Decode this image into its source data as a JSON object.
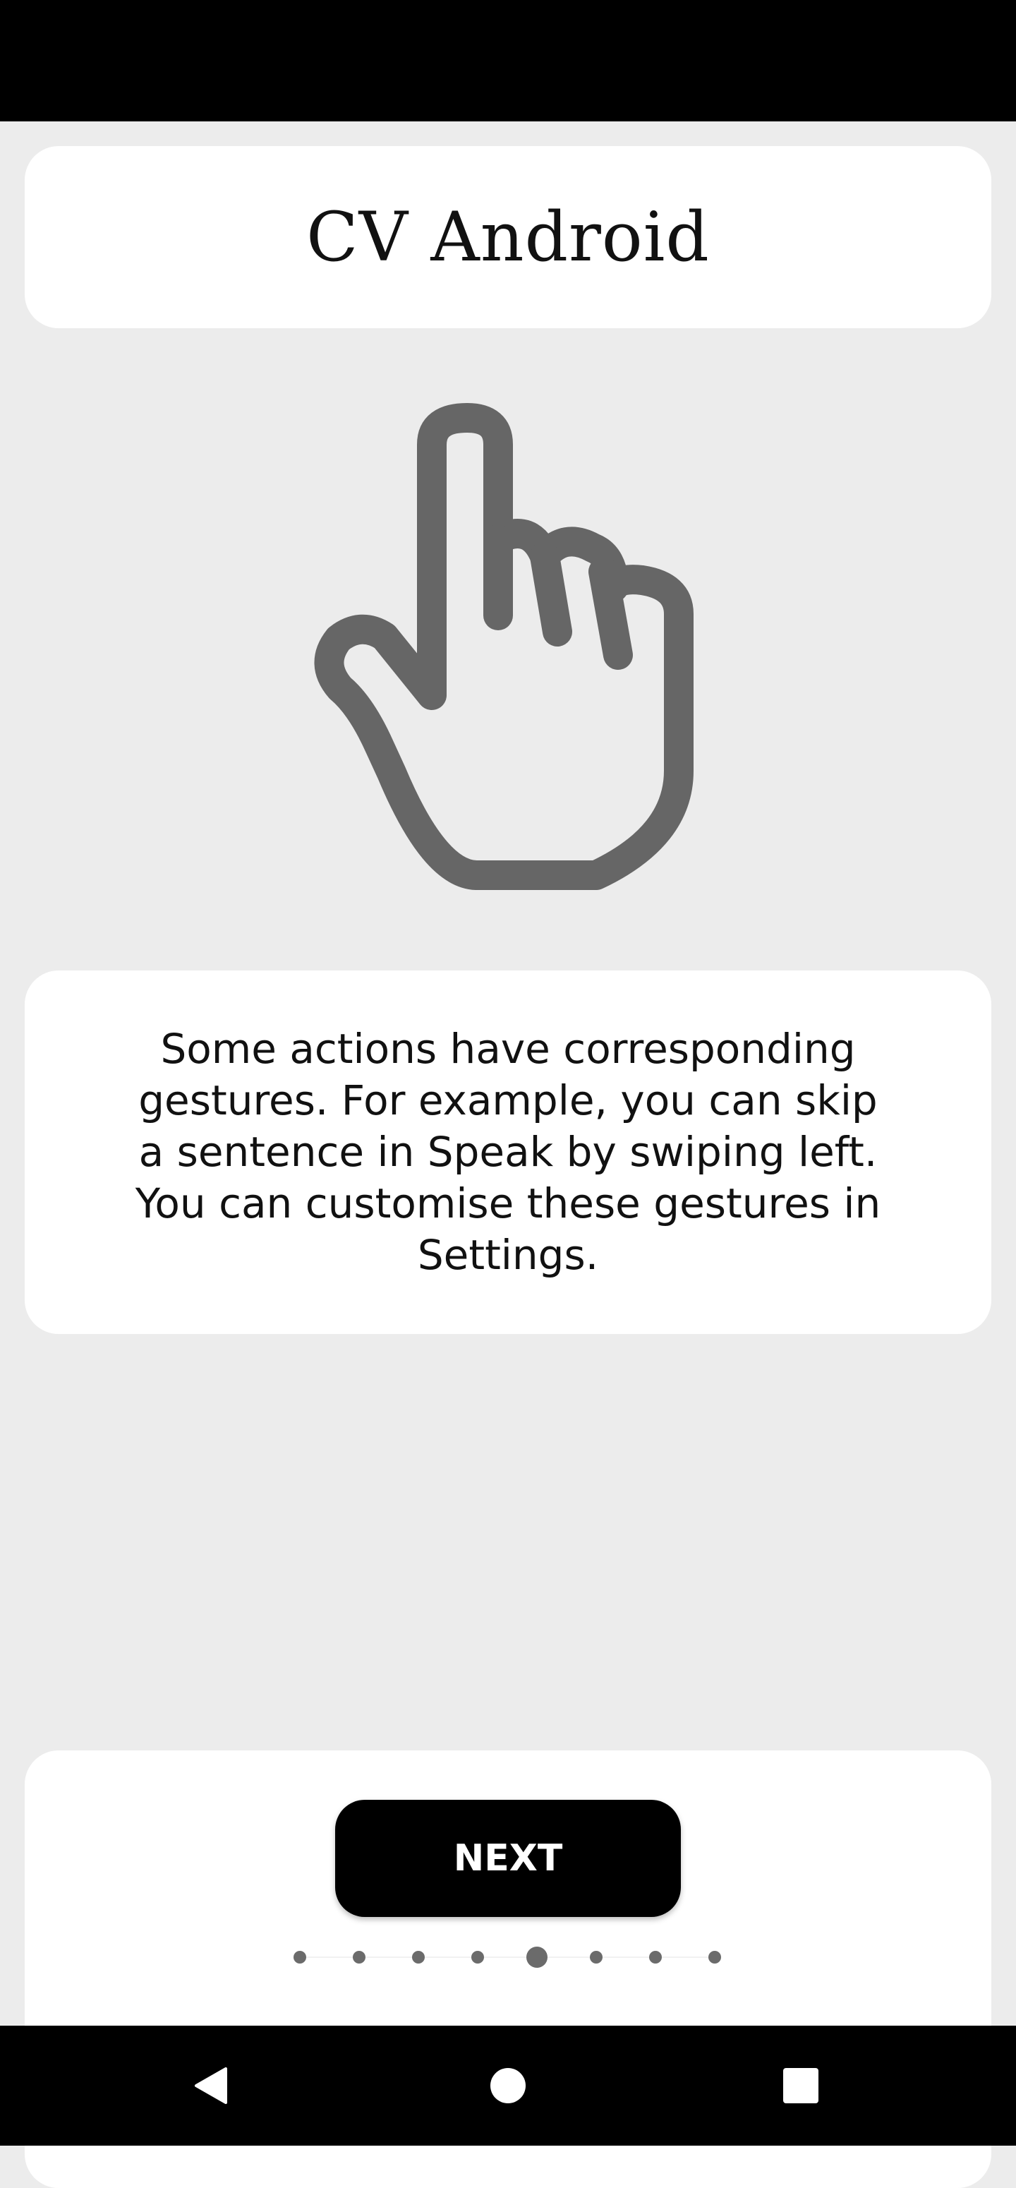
{
  "app_title": "CV Android",
  "illustration": {
    "icon": "pointing-hand-icon",
    "color": "#666666"
  },
  "description": "Some actions have corresponding gestures. For example, you can skip a sentence in Speak by swiping left. You can customise these gestures in Settings.",
  "next_button": {
    "label": "NEXT"
  },
  "pager": {
    "total_pages": 8,
    "current_page": 5
  },
  "nav_bar": {
    "back_icon": "back-triangle-icon",
    "home_icon": "home-circle-icon",
    "recents_icon": "recents-square-icon"
  },
  "colors": {
    "background": "#ececec",
    "card": "#ffffff",
    "button": "#000000",
    "dot": "#6b6b6b"
  }
}
